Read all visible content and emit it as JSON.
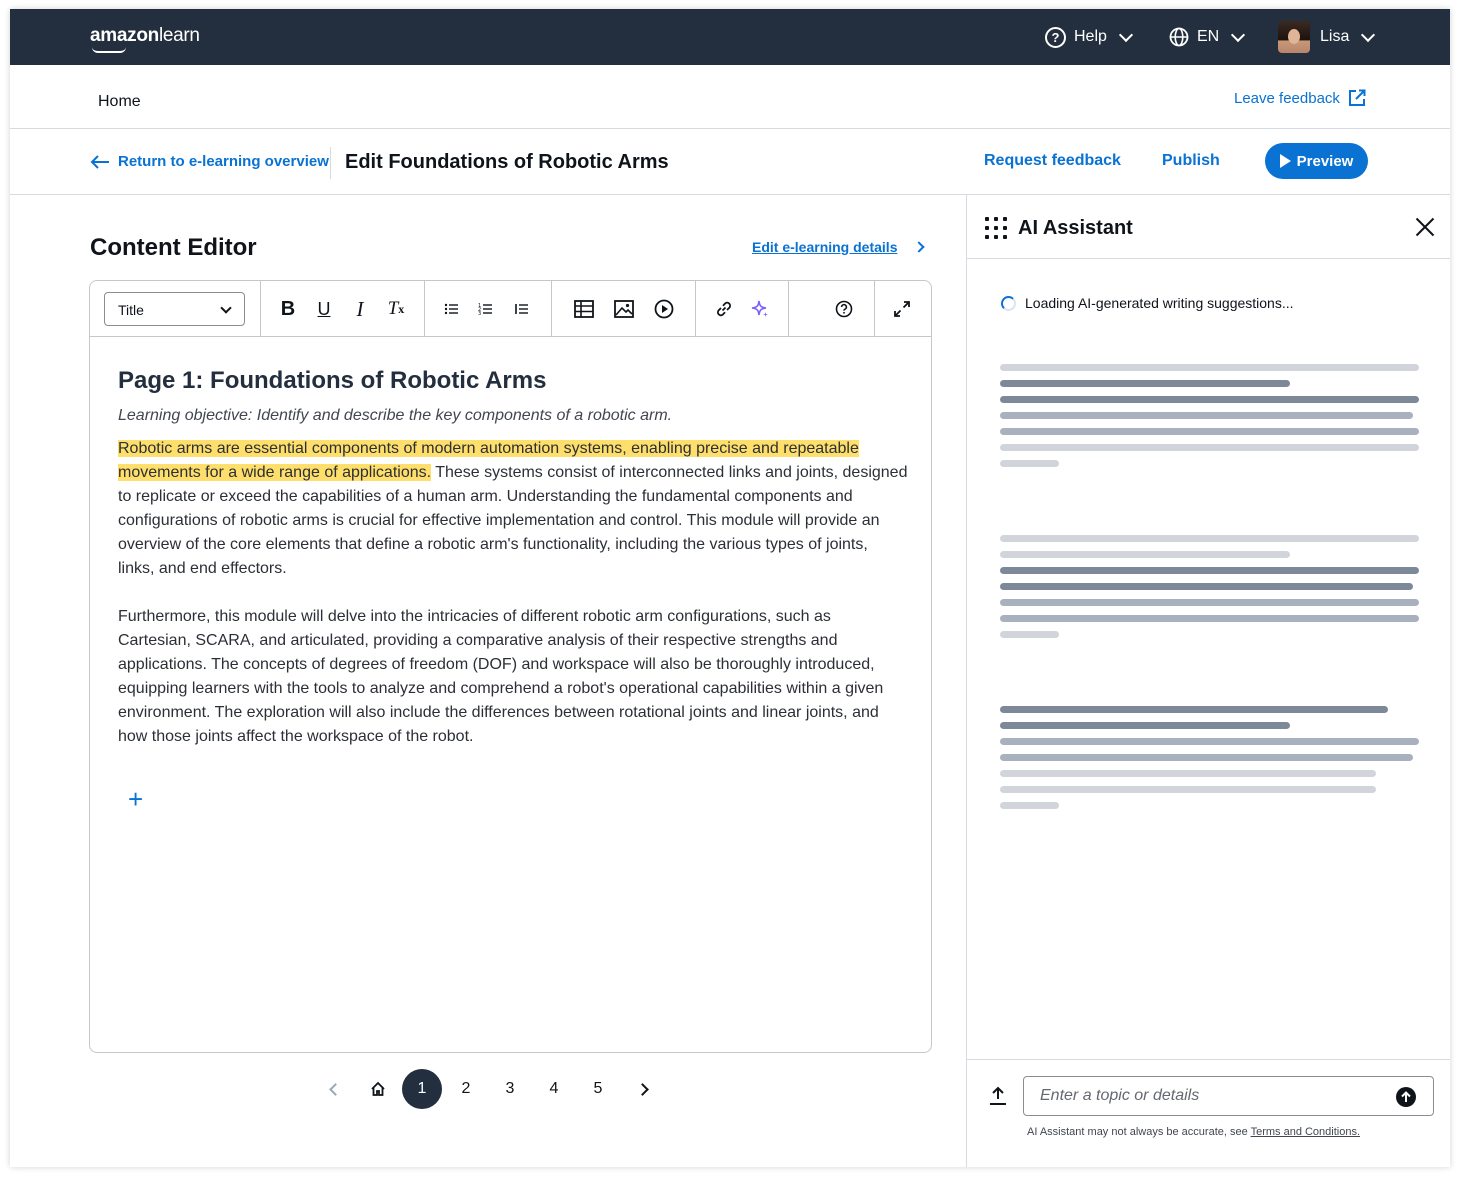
{
  "topnav": {
    "logo_brand": "amazon",
    "logo_product": "learn",
    "help_label": "Help",
    "lang_label": "EN",
    "user_name": "Lisa"
  },
  "breadcrumb": {
    "home": "Home",
    "leave_feedback": "Leave feedback"
  },
  "header": {
    "back_label": "Return to e-learning overview",
    "title": "Edit Foundations of Robotic Arms",
    "request_feedback": "Request feedback",
    "publish": "Publish",
    "preview": "Preview"
  },
  "editor": {
    "section_title": "Content Editor",
    "edit_details": "Edit e-learning details",
    "style_select": "Title",
    "toolbar": {
      "bold": "B",
      "underline": "U",
      "italic": "I",
      "clear_format": "T"
    },
    "heading": "Page 1: Foundations of Robotic Arms",
    "objective": "Learning objective: Identify and describe the key components of a robotic arm.",
    "para1_highlight": "Robotic arms are essential components of modern automation systems, enabling precise and repeatable movements for a wide range of applications.",
    "para1_rest": " These systems consist of interconnected links and joints, designed to replicate or exceed the capabilities of a human arm. Understanding the fundamental components and configurations of robotic arms is crucial for effective implementation and control. This module will provide an overview of the core elements that define a robotic arm's functionality, including the various types of joints, links, and end effectors.",
    "para2": "Furthermore, this module will delve into the intricacies of different robotic arm configurations, such as Cartesian, SCARA, and articulated, providing a comparative analysis of their respective strengths and applications. The concepts of degrees of freedom (DOF) and workspace will also be thoroughly introduced, equipping learners with the tools to analyze and comprehend a robot's operational capabilities within a given environment. The exploration will also include the differences between rotational joints and linear joints, and how those joints affect the workspace of the robot.",
    "add_block": "+"
  },
  "pagination": {
    "pages": [
      "1",
      "2",
      "3",
      "4",
      "5"
    ],
    "current": "1"
  },
  "assistant": {
    "title": "AI Assistant",
    "loading_text": "Loading AI-generated writing suggestions...",
    "input_placeholder": "Enter a topic or details",
    "disclaimer": "AI Assistant may not always be accurate, see ",
    "terms_link": "Terms and Conditions."
  },
  "colors": {
    "nav_bg": "#232f3e",
    "link": "#0972d3",
    "highlight": "#ffdf6b",
    "active_page": "#232f3e"
  }
}
